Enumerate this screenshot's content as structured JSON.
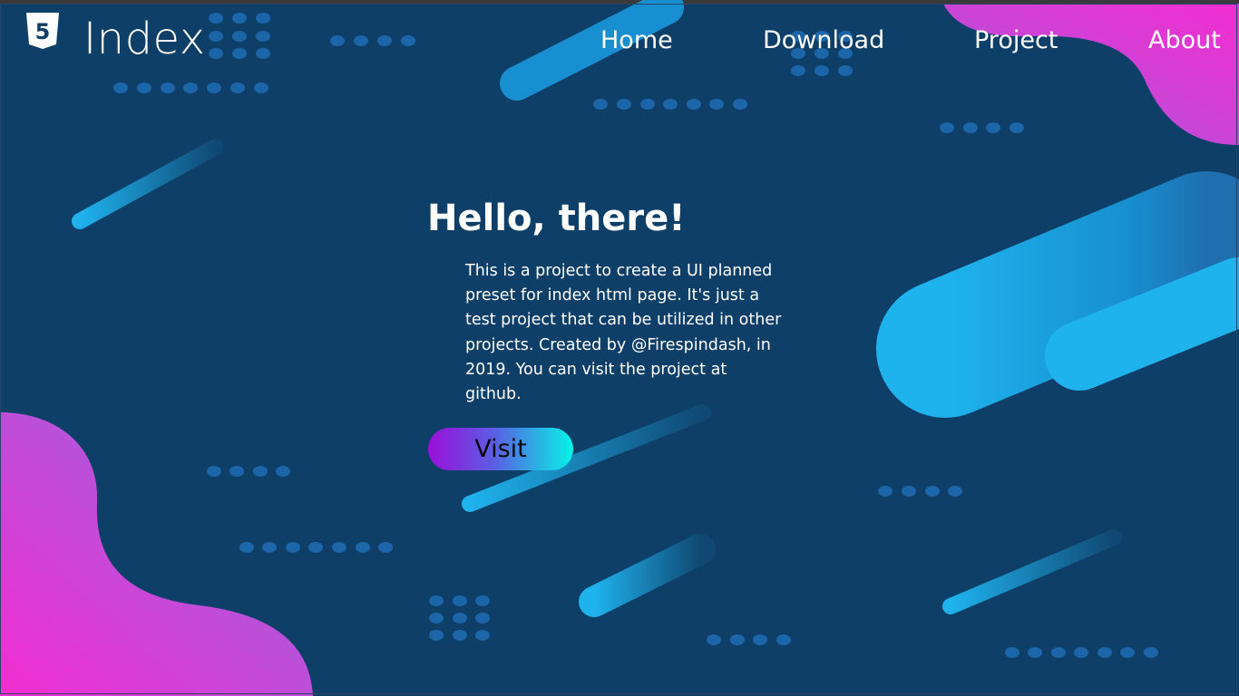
{
  "header": {
    "brand": "Index",
    "logo_icon": "html5-logo-icon",
    "logo_glyph": "5"
  },
  "nav": {
    "home": "Home",
    "download": "Download",
    "project": "Project",
    "about": "About"
  },
  "hero": {
    "title": "Hello, there!",
    "description": "This is a project to create a UI planned preset for index html page. It's just a test project that can be utilized in other projects. Created by @Firespindash, in 2019. You can visit the project at github.",
    "button_label": "Visit"
  },
  "colors": {
    "background": "#0e3f68",
    "dots": "#1c65a8",
    "blob_pink": "#f22dd0",
    "blob_violet": "#8d6de0",
    "pill_cyan": "#1fb3ee",
    "button_start": "#9b0fd9",
    "button_end": "#06f3e6"
  }
}
